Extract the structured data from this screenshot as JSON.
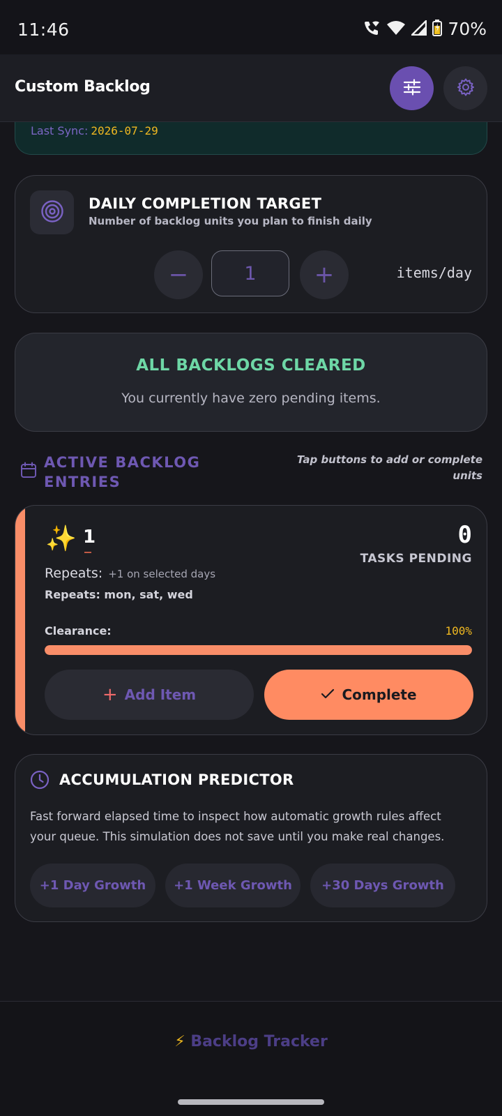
{
  "status_bar": {
    "time": "11:46",
    "battery": "70%",
    "icons": [
      "phone-wifi-icon",
      "wifi-icon",
      "signal-icon",
      "battery-icon"
    ]
  },
  "header": {
    "title": "Custom Backlog",
    "filter_icon": "sliders-icon",
    "settings_icon": "gear-icon",
    "accent_color": "#6a4fb0"
  },
  "sync": {
    "label": "Last Sync:",
    "date": "2026-07-29"
  },
  "daily_target": {
    "title": "DAILY COMPLETION TARGET",
    "subtitle": "Number of backlog units you plan to finish daily",
    "minus_label": "−",
    "plus_label": "+",
    "value": "1",
    "unit": "items/day",
    "icon": "target-icon"
  },
  "cleared": {
    "title": "ALL BACKLOGS CLEARED",
    "message": "You currently have zero pending items.",
    "color": "#6ed7a6"
  },
  "entries_section": {
    "title": "ACTIVE BACKLOG ENTRIES",
    "hint": "Tap buttons to add or complete units",
    "icon": "calendar-icon"
  },
  "entries": [
    {
      "emoji": "✨",
      "name": "1",
      "pending_count": "0",
      "pending_label": "TASKS PENDING",
      "repeats_label": "Repeats:",
      "repeats_note": "+1 on selected days",
      "repeat_days": "Repeats: mon, sat, wed",
      "clearance_label": "Clearance:",
      "clearance_text": "100%",
      "clearance_value": 1.0,
      "stripe_color": "#f98d68",
      "add_label": "Add Item",
      "complete_label": "Complete"
    }
  ],
  "predictor": {
    "title": "ACCUMULATION PREDICTOR",
    "description": "Fast forward elapsed time to inspect how automatic growth rules affect your queue. This simulation does not save until you make real changes.",
    "buttons": [
      "+1 Day Growth",
      "+1 Week Growth",
      "+30 Days Growth"
    ],
    "icon": "clock-icon"
  },
  "footer": {
    "bolt": "⚡",
    "text": "Backlog Tracker"
  }
}
